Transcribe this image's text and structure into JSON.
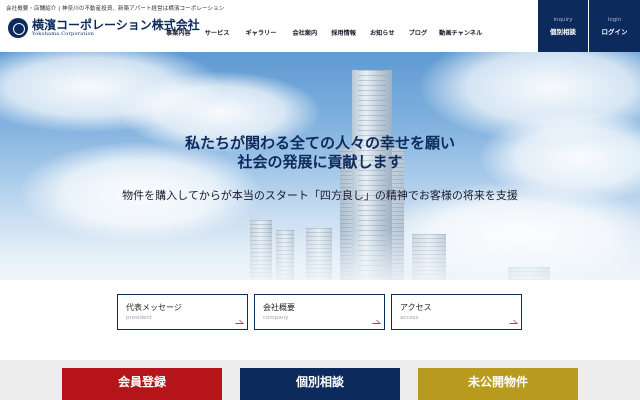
{
  "header": {
    "tagline": "会社概要・店舗紹介 | 神奈川の不動産投資、新築アパート経営は横濱コーポレーション",
    "logo": {
      "name": "横濱コーポレーション株式会社",
      "name_en": "Yokohama Corporation"
    },
    "nav": [
      {
        "label": "事業内容"
      },
      {
        "label": "サービス"
      },
      {
        "label": "ギャラリー"
      },
      {
        "label": "会社案内"
      },
      {
        "label": "採用情報"
      },
      {
        "label": "お知らせ"
      },
      {
        "label": "ブログ"
      },
      {
        "label": "動画チャンネル"
      }
    ],
    "consult": {
      "en": "inquiry",
      "ja": "個別相談"
    },
    "login": {
      "en": "login",
      "ja": "ログイン"
    }
  },
  "hero": {
    "line1": "私たちが関わる全ての人々の幸せを願い",
    "line2": "社会の発展に貢献します",
    "sub": "物件を購入してからが本当のスタート「四方良し」の精神でお客様の将来を支援"
  },
  "cards": [
    {
      "title": "代表メッセージ",
      "sub": "president"
    },
    {
      "title": "会社概要",
      "sub": "company"
    },
    {
      "title": "アクセス",
      "sub": "access"
    }
  ],
  "bottom": [
    {
      "label": "会員登録",
      "color": "#b4141a"
    },
    {
      "label": "個別相談",
      "color": "#0d2a5c"
    },
    {
      "label": "未公開物件",
      "color": "#b89a1e"
    }
  ],
  "colors": {
    "brand_navy": "#0d2a5c",
    "accent_red": "#b4141a",
    "accent_gold": "#b89a1e"
  }
}
